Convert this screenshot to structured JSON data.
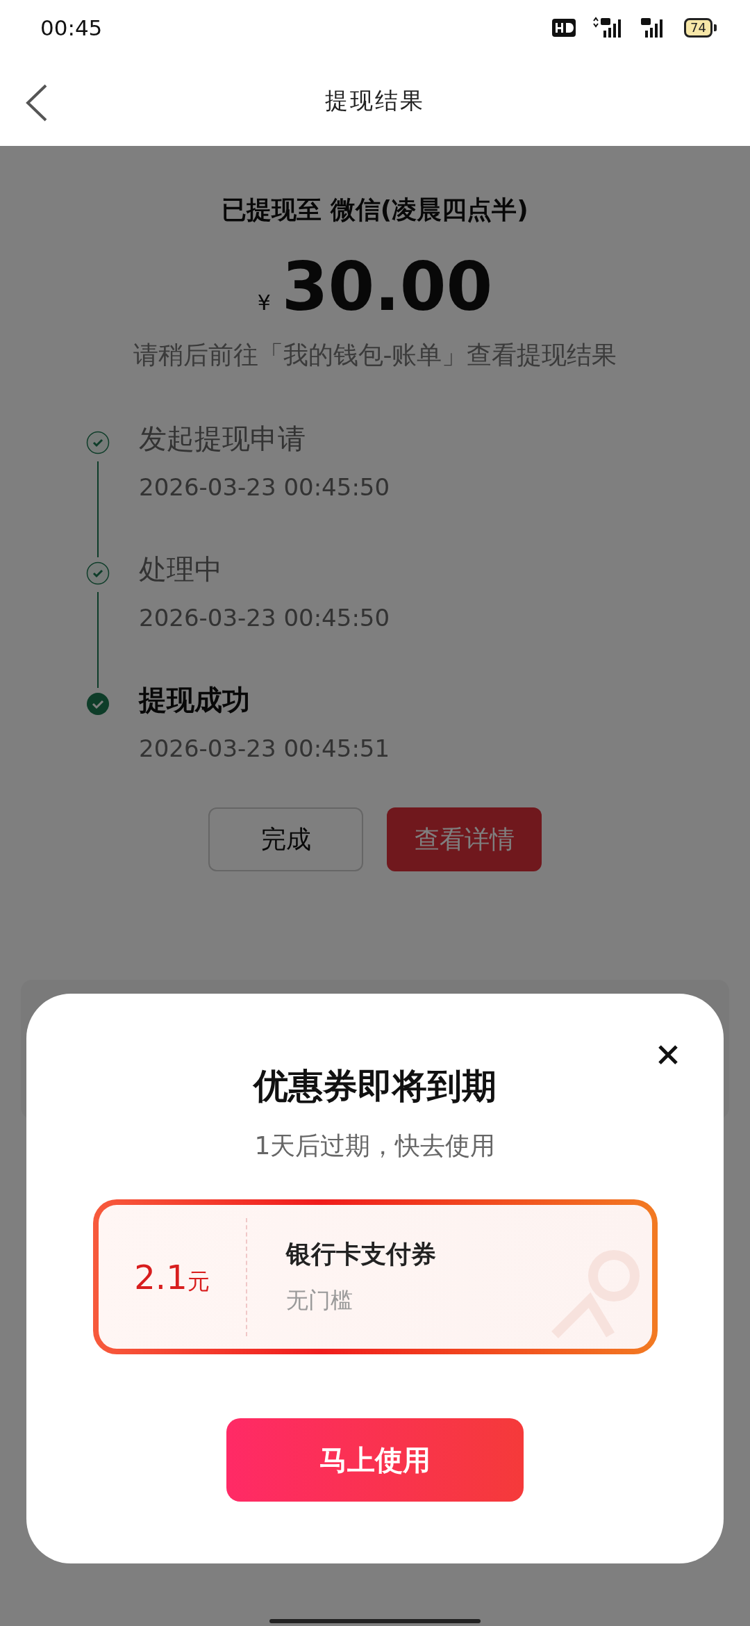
{
  "status_bar": {
    "time": "00:45",
    "battery": "74"
  },
  "header": {
    "title": "提现结果"
  },
  "result": {
    "destination": "已提现至 微信(凌晨四点半)",
    "currency": "¥",
    "amount": "30.00",
    "hint": "请稍后前往「我的钱包-账单」查看提现结果"
  },
  "steps": [
    {
      "title": "发起提现申请",
      "time": "2026-03-23 00:45:50",
      "current": false
    },
    {
      "title": "处理中",
      "time": "2026-03-23 00:45:50",
      "current": false
    },
    {
      "title": "提现成功",
      "time": "2026-03-23 00:45:51",
      "current": true
    }
  ],
  "buttons": [
    {
      "label": "完成",
      "kind": "secondary"
    },
    {
      "label": "查看详情",
      "kind": "primary"
    }
  ],
  "popup": {
    "title": "优惠券即将到期",
    "subtitle": "1天后过期，快去使用",
    "coupon": {
      "amount": "2.1",
      "unit": "元",
      "name": "银行卡支付券",
      "condition": "无门槛"
    },
    "action": "马上使用"
  }
}
